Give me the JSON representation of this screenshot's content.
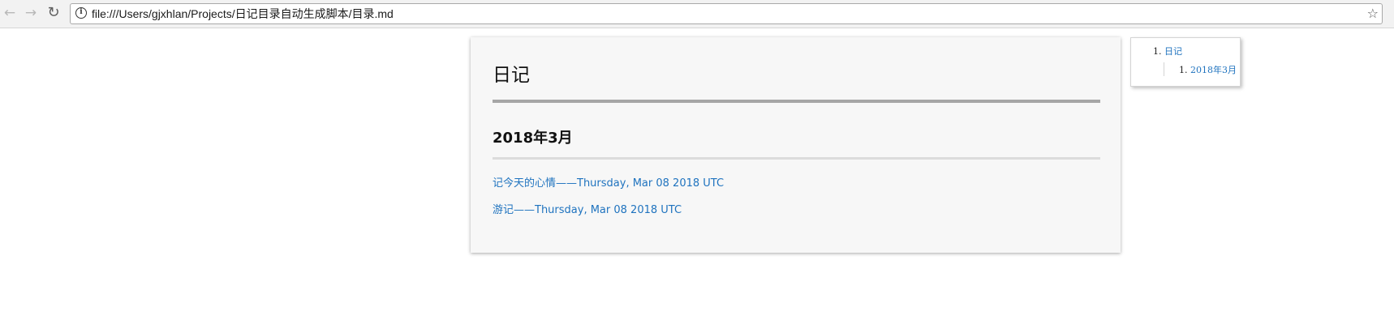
{
  "browser": {
    "back_icon": "back-arrow-icon",
    "forward_icon": "forward-arrow-icon",
    "reload_icon": "reload-icon",
    "info_icon": "info-icon",
    "bookmark_icon": "star-icon",
    "url": "file:///Users/gjxhlan/Projects/日记目录自动生成脚本/目录.md"
  },
  "document": {
    "title": "日记",
    "section_heading": "2018年3月",
    "entries": [
      {
        "label": "记今天的心情——Thursday, Mar 08 2018 UTC"
      },
      {
        "label": "游记——Thursday, Mar 08 2018 UTC"
      }
    ]
  },
  "toc": {
    "items": [
      {
        "number": "1.",
        "label": "日记",
        "children": [
          {
            "number": "1.",
            "label": "2018年3月"
          }
        ]
      }
    ]
  },
  "colors": {
    "link": "#1f73bf",
    "card_background": "#f7f7f7",
    "h1_rule": "#a6a6a6",
    "h2_rule": "#dcdcdc"
  }
}
